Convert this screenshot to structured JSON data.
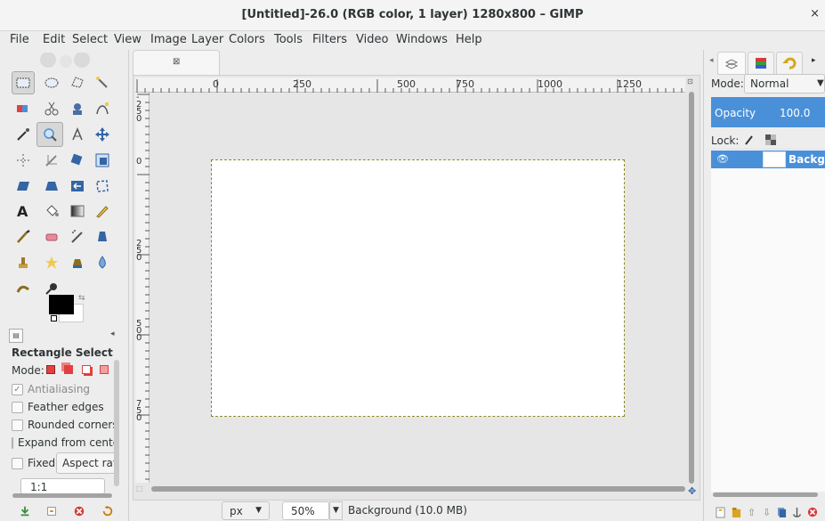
{
  "window": {
    "title": "[Untitled]-26.0 (RGB color, 1 layer) 1280x800 – GIMP",
    "close_glyph": "×"
  },
  "menubar": {
    "items": [
      "File",
      "Edit",
      "Select",
      "View",
      "Image",
      "Layer",
      "Colors",
      "Tools",
      "Filters",
      "Video",
      "Windows",
      "Help"
    ]
  },
  "toolbox": {
    "tools": [
      {
        "name": "rect-select-icon",
        "active": true
      },
      {
        "name": "ellipse-select-icon"
      },
      {
        "name": "free-select-icon"
      },
      {
        "name": "fuzzy-select-icon"
      },
      {
        "name": "select-by-color-icon"
      },
      {
        "name": "scissors-select-icon"
      },
      {
        "name": "foreground-select-icon"
      },
      {
        "name": "paths-icon"
      },
      {
        "name": "color-picker-icon"
      },
      {
        "name": "zoom-icon",
        "active": true
      },
      {
        "name": "measure-icon"
      },
      {
        "name": "move-icon"
      },
      {
        "name": "align-icon"
      },
      {
        "name": "crop-icon"
      },
      {
        "name": "rotate-icon"
      },
      {
        "name": "scale-icon"
      },
      {
        "name": "shear-icon"
      },
      {
        "name": "perspective-icon"
      },
      {
        "name": "flip-icon"
      },
      {
        "name": "cage-transform-icon"
      },
      {
        "name": "text-icon"
      },
      {
        "name": "bucket-fill-icon"
      },
      {
        "name": "blend-icon"
      },
      {
        "name": "pencil-icon"
      },
      {
        "name": "paintbrush-icon"
      },
      {
        "name": "eraser-icon"
      },
      {
        "name": "airbrush-icon"
      },
      {
        "name": "ink-icon"
      },
      {
        "name": "clone-icon"
      },
      {
        "name": "heal-icon"
      },
      {
        "name": "perspective-clone-icon"
      },
      {
        "name": "blur-icon"
      },
      {
        "name": "smudge-icon"
      },
      {
        "name": "dodge-burn-icon"
      }
    ],
    "colors": {
      "foreground": "#000000",
      "background": "#ffffff"
    }
  },
  "tool_options": {
    "title": "Rectangle Select",
    "mode_label": "Mode:",
    "antialiasing": "Antialiasing",
    "feather_edges": "Feather edges",
    "rounded_corners": "Rounded corners",
    "expand_from_center": "Expand from center",
    "fixed_label": "Fixed:",
    "fixed_value": "Aspect ratio",
    "ratio_value": "1:1"
  },
  "rulers": {
    "horizontal": [
      "0",
      "250",
      "500",
      "750",
      "1000",
      "1250"
    ],
    "vertical": [
      "0",
      "250",
      "500",
      "750"
    ],
    "vertical_top": "-250"
  },
  "statusbar": {
    "unit": "px",
    "zoom": "50%",
    "info": "Background (10.0 MB)"
  },
  "layers_dock": {
    "mode_label": "Mode:",
    "mode_value": "Normal",
    "opacity_label": "Opacity",
    "opacity_value": "100.0",
    "lock_label": "Lock:",
    "layer_name": "Background"
  },
  "accent_color": "#4a90d9"
}
